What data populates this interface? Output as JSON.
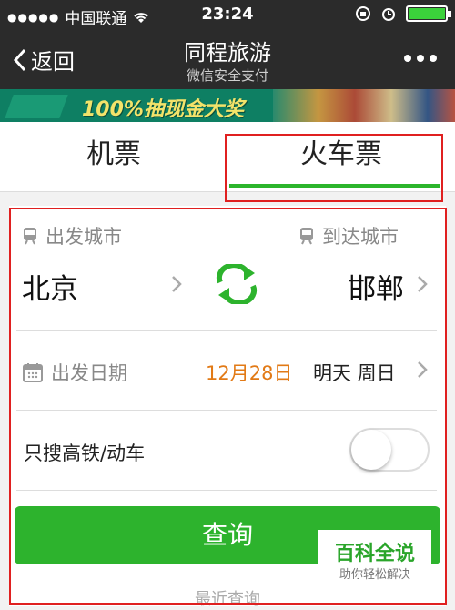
{
  "status_bar": {
    "carrier": "中国联通",
    "time": "23:24"
  },
  "nav": {
    "back_label": "返回",
    "title": "同程旅游",
    "subtitle": "微信安全支付"
  },
  "banner": {
    "text": "100%抽现金大奖"
  },
  "tabs": [
    {
      "label": "机票"
    },
    {
      "label": "火车票"
    }
  ],
  "form": {
    "depart_label": "出发城市",
    "arrive_label": "到达城市",
    "depart_city": "北京",
    "arrive_city": "邯郸",
    "date_label": "出发日期",
    "date_value": "12月28日",
    "date_weekday": "明天  周日",
    "high_speed_label": "只搜高铁/动车",
    "search_button": "查询",
    "recent_label": "最近查询"
  },
  "watermark": {
    "title": "百科全说",
    "subtitle": "助你轻松解决"
  },
  "colors": {
    "accent_green": "#2db32d",
    "date_orange": "#e27a16",
    "highlight_red": "#e02020"
  }
}
